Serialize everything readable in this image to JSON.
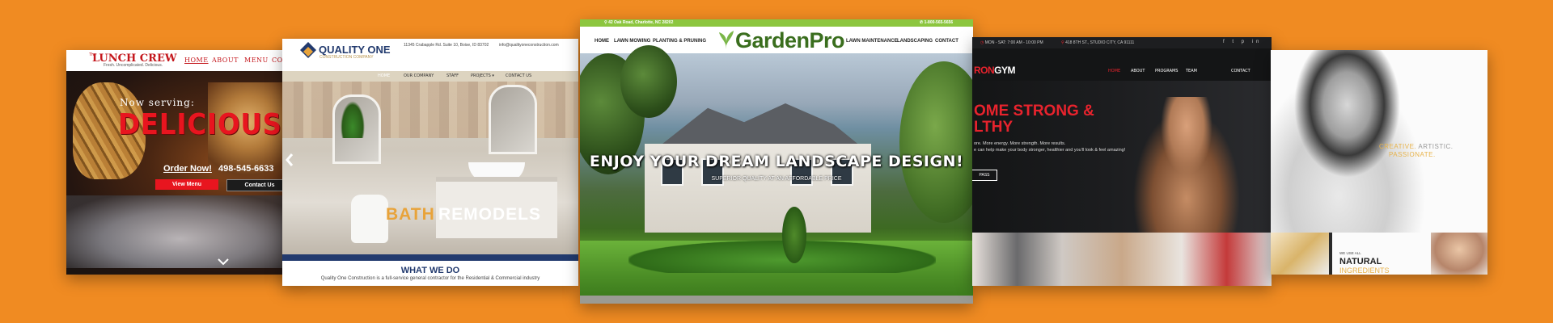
{
  "lunch_crew": {
    "logo": "LUNCH CREW",
    "logo_prefix": "The",
    "tagline": "Fresh. Uncomplicated. Delicious.",
    "nav": [
      "HOME",
      "ABOUT",
      "MENU",
      "CO"
    ],
    "serving": "Now serving:",
    "headline": "DELICIOUS GR",
    "order_link": "Order Now!",
    "phone": "498-545-6633",
    "view_menu": "View Menu",
    "contact_us": "Contact Us"
  },
  "quality_one": {
    "name": "QUALITY ONE",
    "subtitle": "CONSTRUCTION COMPANY",
    "address": "11345 Crabapple Rd. Suite 10, Boise, ID 83702",
    "email": "info@qualityoneconstruction.com",
    "nav": [
      "HOME",
      "OUR COMPANY",
      "STAFF",
      "PROJECTS ▾",
      "CONTACT US"
    ],
    "hero_word1": "BATH",
    "hero_word2": "REMODELS",
    "section_title": "WHAT WE DO",
    "section_desc": "Quality One Construction is a full-service general contractor for the Residential & Commercial industry"
  },
  "garden_pro": {
    "address": "42 Oak Road, Charlotte, NC 28202",
    "phone": "1-800-565-5656",
    "nav_left": [
      "HOME",
      "LAWN MOWING",
      "PLANTING & PRUNING"
    ],
    "nav_right": [
      "LAWN MAINTENANCE",
      "LANDSCAPING",
      "CONTACT"
    ],
    "logo_a": "Garden",
    "logo_b": "Pro",
    "headline": "ENJOY YOUR DREAM LANDSCAPE DESIGN!",
    "subheadline": "SUPERIOR QUALITY AT AN AFFORDABLE PRICE"
  },
  "iron_gym": {
    "hours": "MON - SAT: 7:00 AM - 10:00 PM",
    "address": "418 8TH ST., STUDIO CITY, CA 91111",
    "social": "f t p in",
    "logo_red": "RON",
    "logo_white": "GYM",
    "nav": [
      "HOME",
      "ABOUT",
      "PROGRAMS",
      "TEAM",
      "CONTACT"
    ],
    "headline_1": "OME STRONG &",
    "headline_2": "LTHY",
    "para_1": "ore. More energy. More strength. More results.",
    "para_2": "e can help make your body stronger, healthier and you'll look & feel amazing!",
    "cta": "PASS"
  },
  "creative": {
    "tag_1a": "CREATIVE.",
    "tag_1b": "ARTISTIC.",
    "tag_2": "PASSIONATE.",
    "small": "WE USE ALL",
    "natural": "NATURAL",
    "ingredients": "INGREDIENTS"
  },
  "colors": {
    "background": "#f08b22",
    "lunch_red": "#e8151f",
    "quality_navy": "#223a6e",
    "quality_gold": "#e8a33a",
    "garden_green": "#8cc63f",
    "gym_red": "#e8232d"
  }
}
